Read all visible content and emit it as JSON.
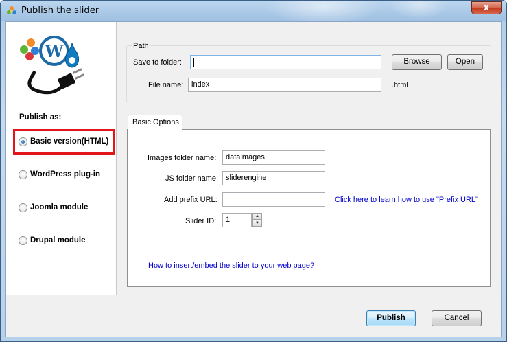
{
  "window": {
    "title": "Publish the slider",
    "close_glyph": "x"
  },
  "left": {
    "publish_as_label": "Publish as:",
    "options": [
      {
        "label": "Basic version(HTML)",
        "selected": true
      },
      {
        "label": "WordPress plug-in",
        "selected": false
      },
      {
        "label": "Joomla module",
        "selected": false
      },
      {
        "label": "Drupal module",
        "selected": false
      }
    ],
    "logo_icon": "cms-plug-logo-icon"
  },
  "path": {
    "legend": "Path",
    "save_to_folder_label": "Save to folder:",
    "save_to_folder_value": "",
    "browse_label": "Browse",
    "open_label": "Open",
    "file_name_label": "File name:",
    "file_name_value": "index",
    "extension": ".html"
  },
  "tabs": [
    {
      "label": "Basic Options",
      "active": true
    }
  ],
  "basic_options": {
    "images_folder_label": "Images folder name:",
    "images_folder_value": "dataimages",
    "js_folder_label": "JS folder name:",
    "js_folder_value": "sliderengine",
    "prefix_url_label": "Add prefix URL:",
    "prefix_url_value": "",
    "prefix_url_help_link": "Click here to learn how to use \"Prefix URL\"",
    "slider_id_label": "Slider ID:",
    "slider_id_value": "1",
    "embed_help_link": "How to insert/embed the slider to your web page?"
  },
  "footer": {
    "publish_label": "Publish",
    "cancel_label": "Cancel"
  },
  "colors": {
    "highlight": "#e2151a",
    "link": "#0000cc",
    "titlebar": "#a9c8e6"
  }
}
